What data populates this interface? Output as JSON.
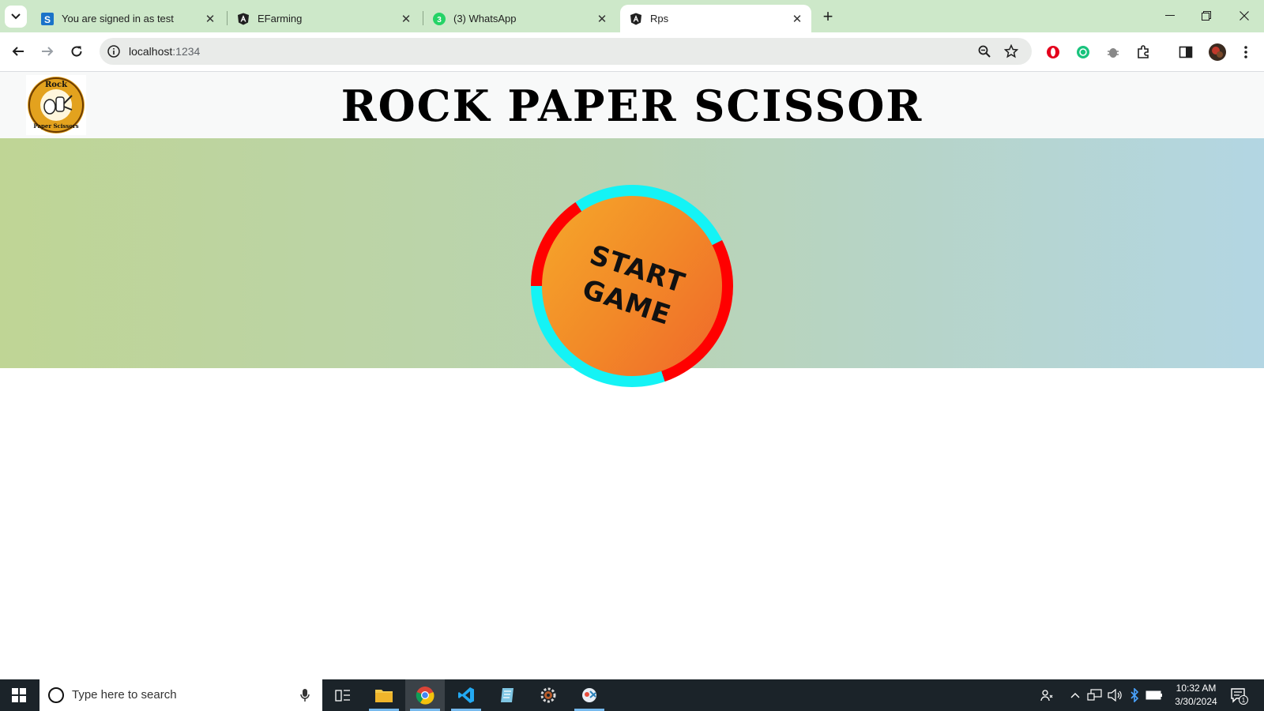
{
  "browser": {
    "tabs": [
      {
        "title": "You are signed in as test",
        "icon": "s-letter-icon",
        "active": false
      },
      {
        "title": "EFarming",
        "icon": "angular-icon",
        "active": false
      },
      {
        "title": "(3) WhatsApp",
        "icon": "whatsapp-icon",
        "active": false
      },
      {
        "title": "Rps",
        "icon": "angular-icon",
        "active": true
      }
    ],
    "address": {
      "host": "localhost",
      "port": ":1234"
    }
  },
  "page": {
    "title": "ROCK PAPER SCISSOR",
    "logo": {
      "line1": "Rock",
      "line2": "Paper Scissors"
    },
    "start_button": {
      "line1": "START",
      "line2": "GAME"
    }
  },
  "taskbar": {
    "search_placeholder": "Type here to search",
    "time": "10:32 AM",
    "date": "3/30/2024",
    "notification_count": "1"
  },
  "colors": {
    "tabstrip": "#cde8c9",
    "hero_left": "#bfd595",
    "hero_right": "#b3d6e3",
    "ring_cyan": "#14f3f5",
    "ring_red": "#ff0000",
    "button_orange": "#f28a28"
  }
}
